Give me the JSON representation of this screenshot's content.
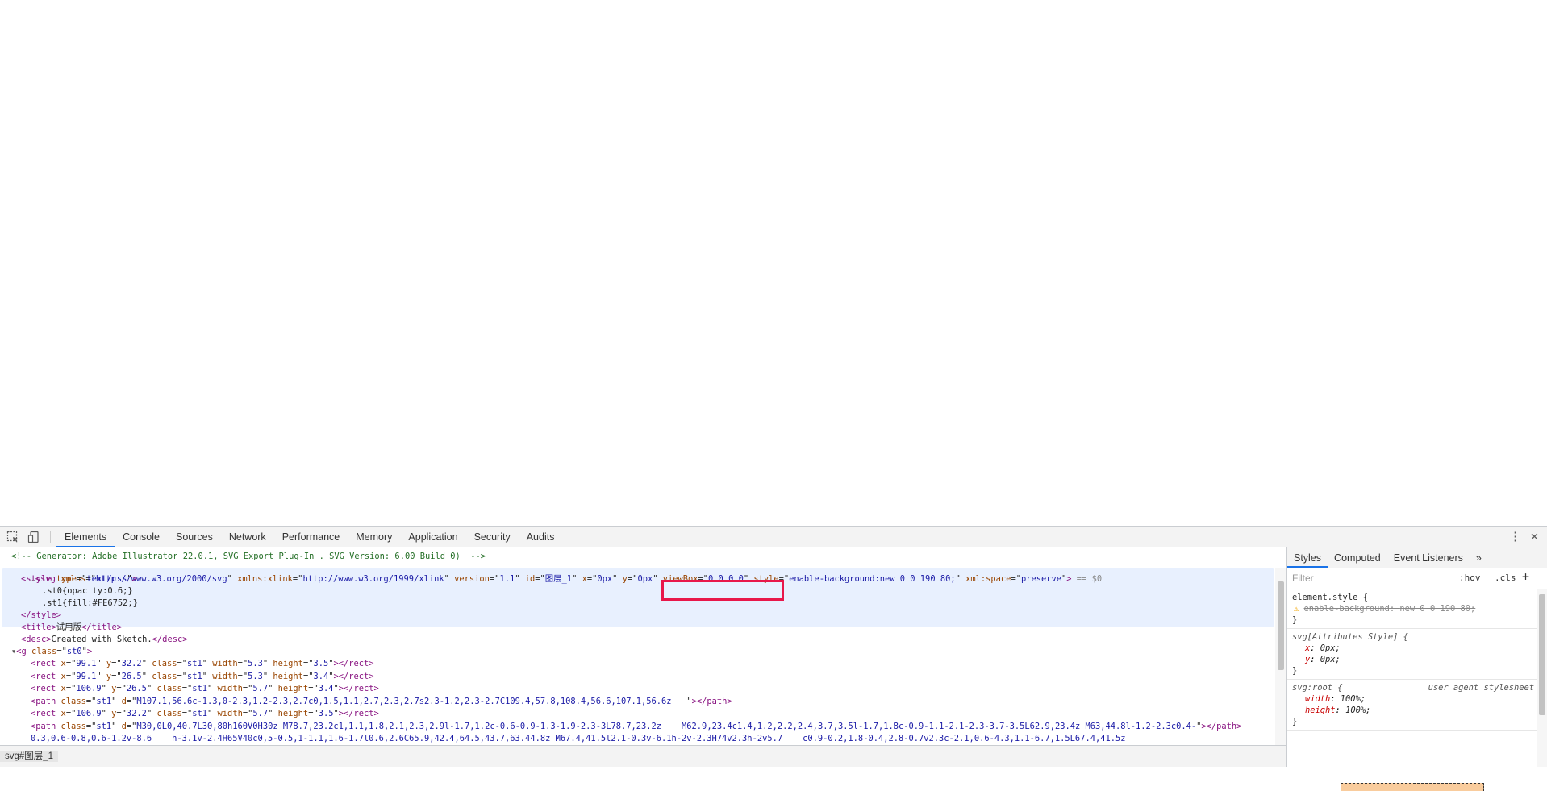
{
  "devtools": {
    "tabs": [
      "Elements",
      "Console",
      "Sources",
      "Network",
      "Performance",
      "Memory",
      "Application",
      "Security",
      "Audits"
    ],
    "more_menu": "⋮",
    "close": "✕"
  },
  "dom": {
    "comment": "<!-- Generator: Adobe Illustrator 22.0.1, SVG Export Plug-In . SVG Version: 6.00 Build 0)  -->",
    "svg": {
      "ellipsis": "…",
      "tag": "svg",
      "attrs": [
        {
          "n": "xmlns",
          "v": "http://www.w3.org/2000/svg"
        },
        {
          "n": "xmlns:xlink",
          "v": "http://www.w3.org/1999/xlink"
        },
        {
          "n": "version",
          "v": "1.1"
        },
        {
          "n": "id",
          "v": "图层_1"
        },
        {
          "n": "x",
          "v": "0px"
        },
        {
          "n": "y",
          "v": "0px"
        },
        {
          "n": "viewBox",
          "v": "0 0 0 0"
        },
        {
          "n": "style",
          "v": "enable-background:new 0 0 190 80;"
        },
        {
          "n": "xml:space",
          "v": "preserve"
        }
      ],
      "eq": "== $0"
    },
    "style_open_tag": "style",
    "style_attr_name": "type",
    "style_attr_val": "text/css",
    "css_line1": ".st0{opacity:0.6;}",
    "css_line2": ".st1{fill:#FE6752;}",
    "style_close": "</style>",
    "title_text": "试用版",
    "desc_text": "Created with Sketch.",
    "g_class": "st0",
    "rows": [
      {
        "tag": "rect",
        "attrs": [
          [
            "x",
            "99.1"
          ],
          [
            "y",
            "32.2"
          ],
          [
            "class",
            "st1"
          ],
          [
            "width",
            "5.3"
          ],
          [
            "height",
            "3.5"
          ]
        ]
      },
      {
        "tag": "rect",
        "attrs": [
          [
            "x",
            "99.1"
          ],
          [
            "y",
            "26.5"
          ],
          [
            "class",
            "st1"
          ],
          [
            "width",
            "5.3"
          ],
          [
            "height",
            "3.4"
          ]
        ]
      },
      {
        "tag": "rect",
        "attrs": [
          [
            "x",
            "106.9"
          ],
          [
            "y",
            "26.5"
          ],
          [
            "class",
            "st1"
          ],
          [
            "width",
            "5.7"
          ],
          [
            "height",
            "3.4"
          ]
        ]
      },
      {
        "tag": "path",
        "attrs": [
          [
            "class",
            "st1"
          ],
          [
            "d",
            "M107.1,56.6c-1.3,0-2.3,1.2-2.3,2.7c0,1.5,1.1,2.7,2.3,2.7s2.3-1.2,2.3-2.7C109.4,57.8,108.4,56.6,107.1,56.6z   "
          ]
        ]
      },
      {
        "tag": "rect",
        "attrs": [
          [
            "x",
            "106.9"
          ],
          [
            "y",
            "32.2"
          ],
          [
            "class",
            "st1"
          ],
          [
            "width",
            "5.7"
          ],
          [
            "height",
            "3.5"
          ]
        ]
      },
      {
        "tag": "path",
        "attrs": [
          [
            "class",
            "st1"
          ],
          [
            "d",
            "M30,0L0,40.7L30,80h160V0H30z M78.7,23.2c1,1.1,1.8,2.1,2.3,2.9l-1.7,1.2c-0.6-0.9-1.3-1.9-2.3-3L78.7,23.2z    M62.9,23.4c1.4,1.2,2.2,2.4,3.7,3.5l-1.7,1.8c-0.9-1.1-2.1-2.3-3.7-3.5L62.9,23.4z M63,44.8l-1.2-2.3c0.4-"
          ]
        ]
      }
    ],
    "row_wrap": "0.3,0.6-0.8,0.6-1.2v-8.6    h-3.1v-2.4H65V40c0,5-0.5,1-1.1,1.6-1.7l0.6,2.6C65.9,42.4,64.5,43.7,63.44.8z M67.4,41.5l2.1-0.3v-6.1h-2v-2.3H74v2.3h-2v5.7    c0.9-0.2,1.8-0.4,2.8-0.7v2.3c-2.1,0.6-4.3,1.1-6.7,1.5L67.4,41.5z"
  },
  "styles_pane": {
    "tabs": [
      "Styles",
      "Computed",
      "Event Listeners"
    ],
    "more": "»",
    "filter_placeholder": "Filter",
    "hov": ":hov",
    "cls": ".cls",
    "plus": "+",
    "rules": {
      "element_style": {
        "selector": "element.style {",
        "prop": "enable-background",
        "value": "new 0 0 190 80;"
      },
      "attr_style": {
        "selector": "svg[Attributes Style] {",
        "props": [
          [
            "x",
            "0px;"
          ],
          [
            "y",
            "0px;"
          ]
        ]
      },
      "root": {
        "selector": "svg:root {",
        "source": "user agent stylesheet",
        "props": [
          [
            "width",
            "100%;"
          ],
          [
            "height",
            "100%;"
          ]
        ]
      },
      "close": "}"
    }
  },
  "breadcrumb": "svg#图层_1",
  "colors": {
    "highlight_box": "#e8174a",
    "selection_bg": "#e8f0fe",
    "tag": "#881280",
    "attr": "#994500",
    "value": "#1a1aa6",
    "comment": "#236e25"
  }
}
